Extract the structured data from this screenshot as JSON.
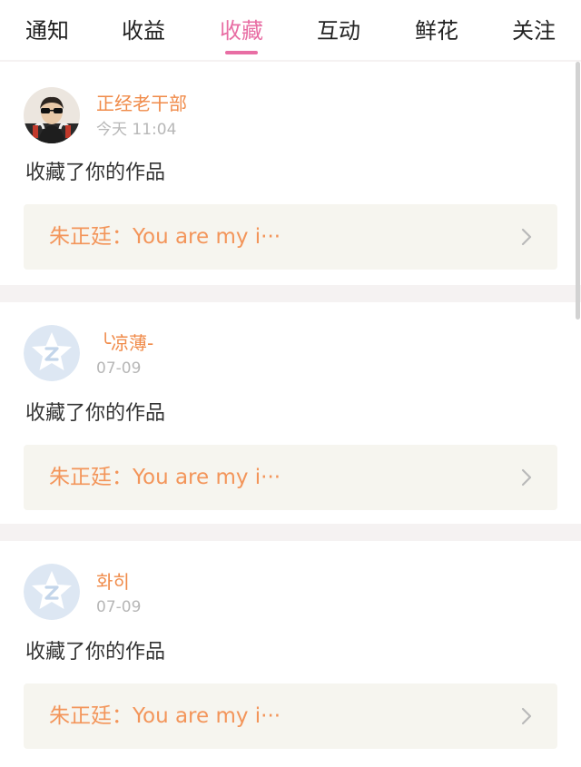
{
  "tabs": [
    {
      "label": "通知",
      "active": false
    },
    {
      "label": "收益",
      "active": false
    },
    {
      "label": "收藏",
      "active": true
    },
    {
      "label": "互动",
      "active": false
    },
    {
      "label": "鲜花",
      "active": false
    },
    {
      "label": "关注",
      "active": false
    }
  ],
  "colors": {
    "accent": "#e86ea4",
    "username": "#f08b4a",
    "work_text": "#f3955a",
    "work_bg": "#f6f5ef",
    "divider": "#f5f2f2"
  },
  "notifications": [
    {
      "username": "正经老干部",
      "time": "今天 11:04",
      "action": "收藏了你的作品",
      "work": "朱正廷：You are my i···",
      "avatar_icon": "user-photo-avatar"
    },
    {
      "username": "╰凉薄-",
      "time": "07-09",
      "action": "收藏了你的作品",
      "work": "朱正廷：You are my i···",
      "avatar_icon": "default-z-avatar-icon"
    },
    {
      "username": "화히",
      "time": "07-09",
      "action": "收藏了你的作品",
      "work": "朱正廷：You are my i···",
      "avatar_icon": "default-z-avatar-icon"
    }
  ]
}
